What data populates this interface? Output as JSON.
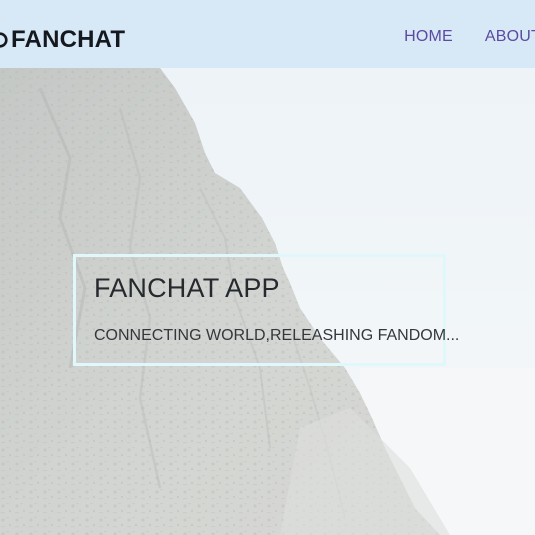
{
  "header": {
    "brand_name": "FANCHAT",
    "brand_icon": "chat-bubble-icon",
    "nav": {
      "home_label": "HOME",
      "about_label": "ABOUT"
    }
  },
  "hero": {
    "title": "FANCHAT APP",
    "subtitle": "CONNECTING WORLD,RELEASHING FANDOM..."
  },
  "colors": {
    "header_bg": "#d7e9f6",
    "nav_link": "#5b4aa0",
    "brand_text": "#15191f",
    "caption_border": "#e0f7fb"
  }
}
